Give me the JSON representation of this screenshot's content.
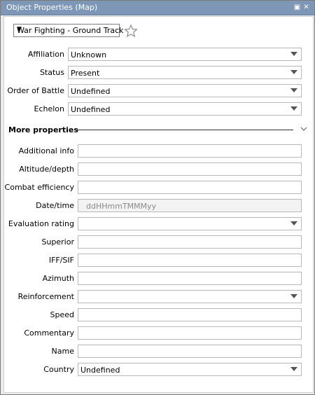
{
  "window": {
    "title": "Object Properties (Map)",
    "maximize_icon": "▣",
    "close_icon": "✕"
  },
  "symbol_set": {
    "selected": "War Fighting - Ground Track"
  },
  "main_fields": [
    {
      "label": "Affiliation",
      "value": "Unknown"
    },
    {
      "label": "Status",
      "value": "Present"
    },
    {
      "label": "Order of Battle",
      "value": "Undefined"
    },
    {
      "label": "Echelon",
      "value": "Undefined"
    }
  ],
  "more": {
    "title": "More properties"
  },
  "more_fields": [
    {
      "label": "Additional info",
      "value": ""
    },
    {
      "label": "Altitude/depth",
      "value": ""
    },
    {
      "label": "Combat efficiency",
      "value": ""
    },
    {
      "label": "Date/time",
      "value": "",
      "placeholder": "ddHHmmTMMMyy"
    },
    {
      "label": "Evaluation rating",
      "value": ""
    },
    {
      "label": "Superior",
      "value": ""
    },
    {
      "label": "IFF/SIF",
      "value": ""
    },
    {
      "label": "Azimuth",
      "value": ""
    },
    {
      "label": "Reinforcement",
      "value": ""
    },
    {
      "label": "Speed",
      "value": ""
    },
    {
      "label": "Commentary",
      "value": ""
    },
    {
      "label": "Name",
      "value": ""
    },
    {
      "label": "Country",
      "value": "Undefined"
    }
  ]
}
